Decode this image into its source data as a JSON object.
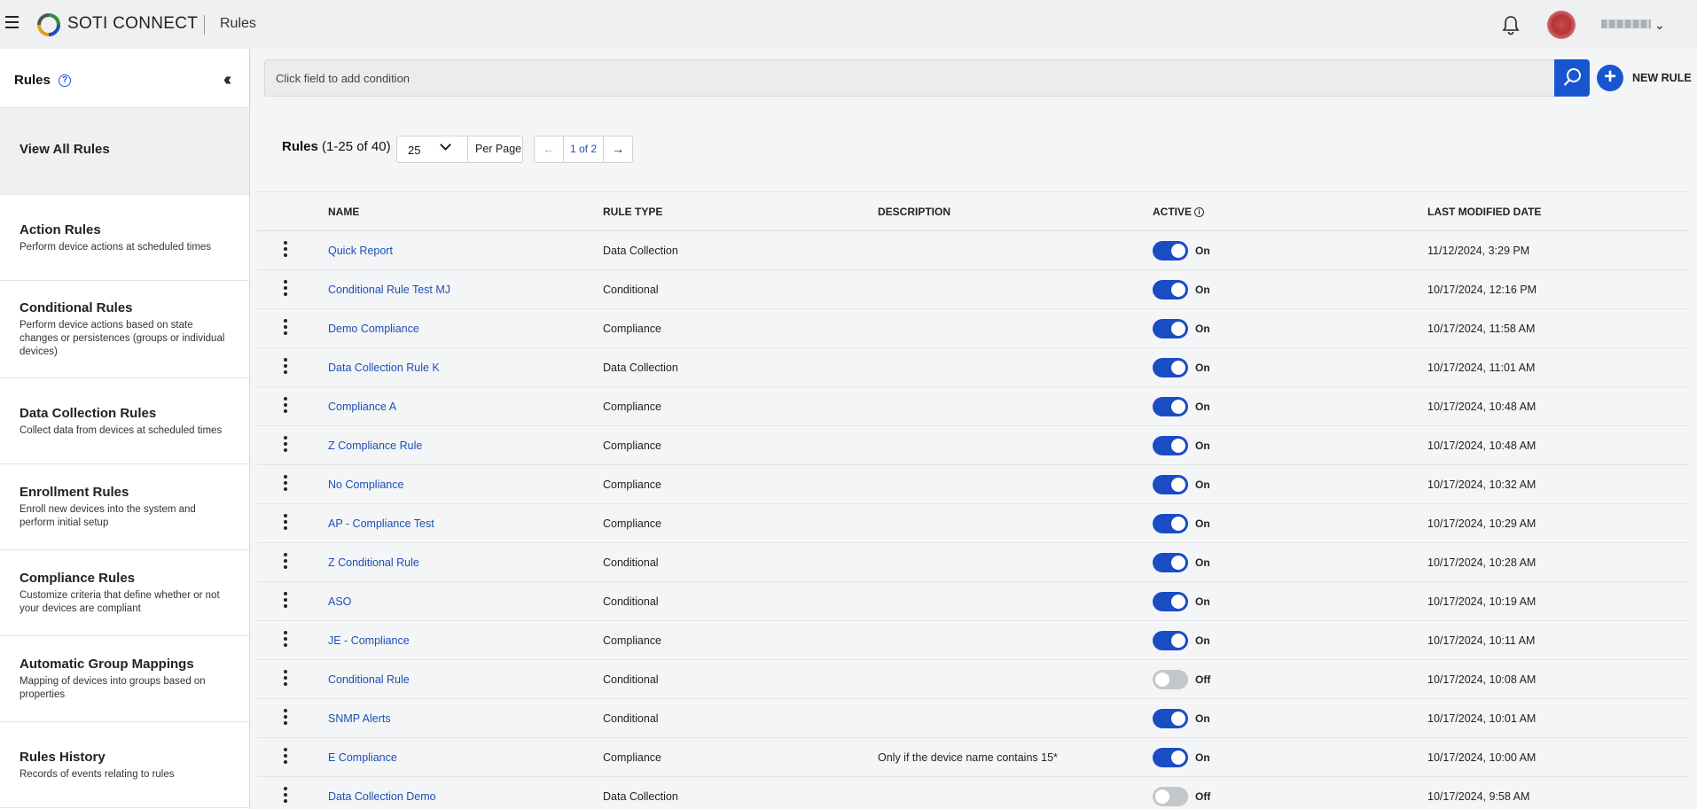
{
  "header": {
    "brand": "SOTI CONNECT",
    "page_name": "Rules"
  },
  "sidebar": {
    "title": "Rules",
    "items": [
      {
        "title": "View All Rules",
        "desc": "",
        "active": true
      },
      {
        "title": "Action Rules",
        "desc": "Perform device actions at scheduled times"
      },
      {
        "title": "Conditional Rules",
        "desc": "Perform device actions based on state changes or persistences (groups or individual devices)"
      },
      {
        "title": "Data Collection Rules",
        "desc": "Collect data from devices at scheduled times"
      },
      {
        "title": "Enrollment Rules",
        "desc": "Enroll new devices into the system and perform initial setup"
      },
      {
        "title": "Compliance Rules",
        "desc": "Customize criteria that define whether or not your devices are compliant"
      },
      {
        "title": "Automatic Group Mappings",
        "desc": "Mapping of devices into groups based on properties"
      },
      {
        "title": "Rules History",
        "desc": "Records of events relating to rules"
      }
    ]
  },
  "filter": {
    "placeholder": "Click field to add condition",
    "new_rule_label": "NEW RULE"
  },
  "list": {
    "title": "Rules",
    "range": "(1-25 of 40)",
    "per_page_value": "25",
    "per_page_label": "Per Page",
    "page": "1 of 2",
    "prev_arrow": "←",
    "next_arrow": "→"
  },
  "table": {
    "headers": [
      "NAME",
      "RULE TYPE",
      "DESCRIPTION",
      "ACTIVE",
      "LAST MODIFIED DATE"
    ],
    "rows": [
      {
        "name": "Quick Report",
        "type": "Data Collection",
        "desc": "",
        "active": true,
        "active_label": "On",
        "modified": "11/12/2024, 3:29 PM"
      },
      {
        "name": "Conditional Rule Test MJ",
        "type": "Conditional",
        "desc": "",
        "active": true,
        "active_label": "On",
        "modified": "10/17/2024, 12:16 PM"
      },
      {
        "name": "Demo Compliance",
        "type": "Compliance",
        "desc": "",
        "active": true,
        "active_label": "On",
        "modified": "10/17/2024, 11:58 AM"
      },
      {
        "name": "Data Collection Rule K",
        "type": "Data Collection",
        "desc": "",
        "active": true,
        "active_label": "On",
        "modified": "10/17/2024, 11:01 AM"
      },
      {
        "name": "Compliance A",
        "type": "Compliance",
        "desc": "",
        "active": true,
        "active_label": "On",
        "modified": "10/17/2024, 10:48 AM"
      },
      {
        "name": "Z Compliance Rule",
        "type": "Compliance",
        "desc": "",
        "active": true,
        "active_label": "On",
        "modified": "10/17/2024, 10:48 AM"
      },
      {
        "name": "No Compliance",
        "type": "Compliance",
        "desc": "",
        "active": true,
        "active_label": "On",
        "modified": "10/17/2024, 10:32 AM"
      },
      {
        "name": "AP - Compliance Test",
        "type": "Compliance",
        "desc": "",
        "active": true,
        "active_label": "On",
        "modified": "10/17/2024, 10:29 AM"
      },
      {
        "name": "Z Conditional Rule",
        "type": "Conditional",
        "desc": "",
        "active": true,
        "active_label": "On",
        "modified": "10/17/2024, 10:28 AM"
      },
      {
        "name": "ASO",
        "type": "Conditional",
        "desc": "",
        "active": true,
        "active_label": "On",
        "modified": "10/17/2024, 10:19 AM"
      },
      {
        "name": "JE - Compliance",
        "type": "Compliance",
        "desc": "",
        "active": true,
        "active_label": "On",
        "modified": "10/17/2024, 10:11 AM"
      },
      {
        "name": "Conditional Rule",
        "type": "Conditional",
        "desc": "",
        "active": false,
        "active_label": "Off",
        "modified": "10/17/2024, 10:08 AM"
      },
      {
        "name": "SNMP Alerts",
        "type": "Conditional",
        "desc": "",
        "active": true,
        "active_label": "On",
        "modified": "10/17/2024, 10:01 AM"
      },
      {
        "name": "E Compliance",
        "type": "Compliance",
        "desc": "Only if the device name contains 15*",
        "active": true,
        "active_label": "On",
        "modified": "10/17/2024, 10:00 AM"
      },
      {
        "name": "Data Collection Demo",
        "type": "Data Collection",
        "desc": "",
        "active": false,
        "active_label": "Off",
        "modified": "10/17/2024, 9:58 AM"
      }
    ]
  },
  "colors": {
    "accent": "#1856d1",
    "link": "#1c4fb4",
    "toggle_on": "#1a4cc4",
    "toggle_off": "#c4c7ca"
  }
}
